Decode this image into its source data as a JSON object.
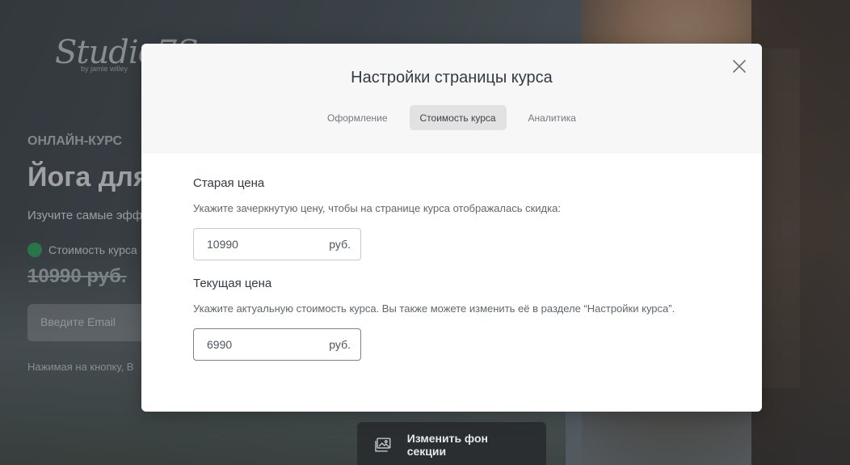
{
  "background": {
    "logo": "Studio7S",
    "logo_sub": "by jamie willey",
    "eyebrow": "ОНЛАЙН-КУРС",
    "hero_title": "Йога для",
    "hero_subtitle": "Изучите самые эфф",
    "price_label": "Стоимость курса",
    "old_price": "10990 руб.",
    "email_placeholder": "Введите Email",
    "hint": "Нажимая на кнопку, В",
    "change_bg_button": "Изменить фон секции"
  },
  "modal": {
    "title": "Настройки страницы курса",
    "tabs": [
      {
        "label": "Оформление",
        "active": false
      },
      {
        "label": "Стоимость курса",
        "active": true
      },
      {
        "label": "Аналитика",
        "active": false
      }
    ],
    "old_price": {
      "title": "Старая цена",
      "description": "Укажите зачеркнутую цену, чтобы на странице курса отображалась скидка:",
      "value": "10990",
      "unit": "руб."
    },
    "current_price": {
      "title": "Текущая цена",
      "description": "Укажите актуальную стоимость курса. Вы также можете изменить её в разделе “Настройки курса”.",
      "value": "6990",
      "unit": "руб."
    }
  },
  "colors": {
    "accent_green": "#2fa35a",
    "active_tab_bg": "#e2e2e2"
  }
}
